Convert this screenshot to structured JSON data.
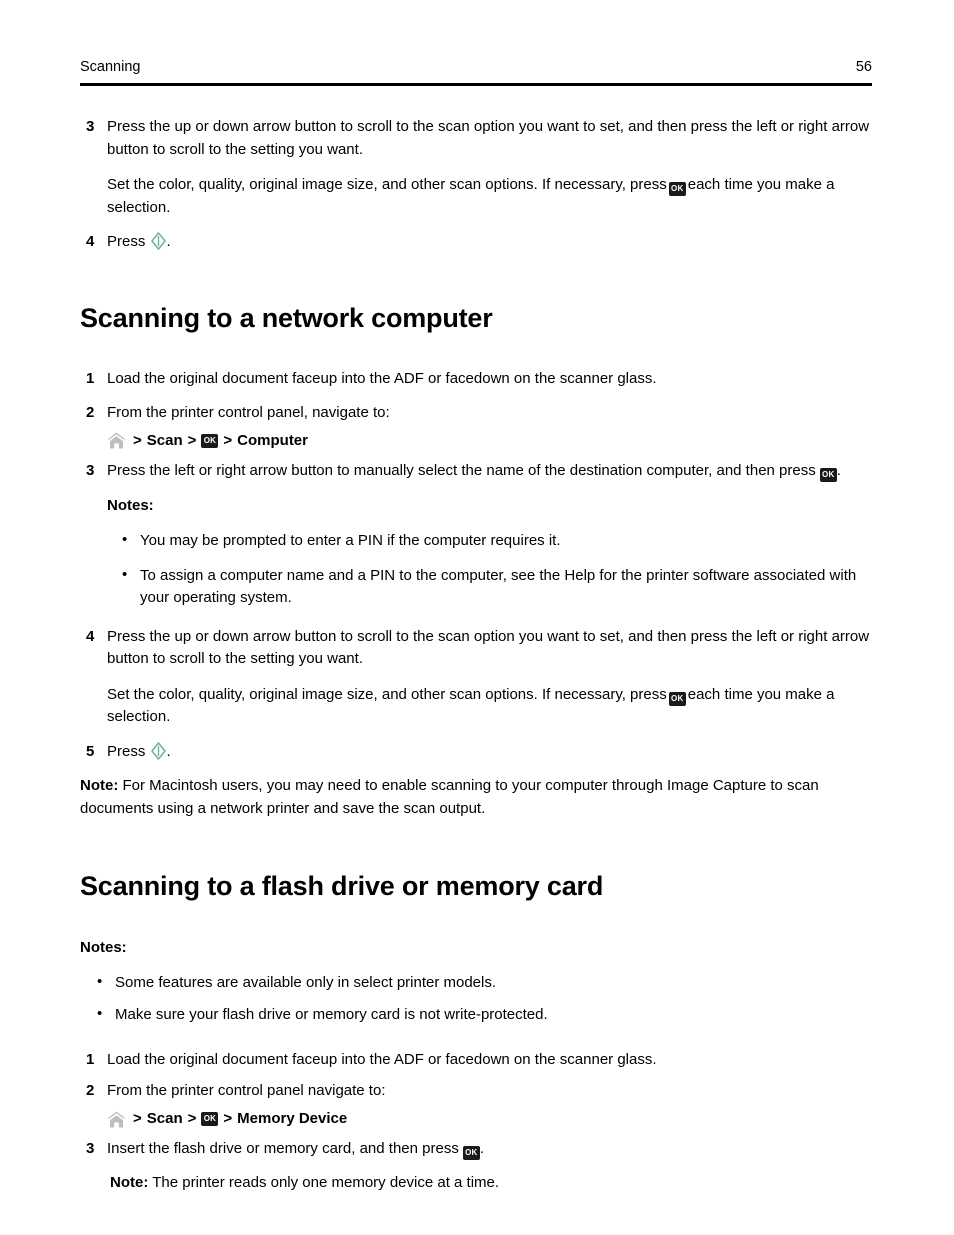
{
  "header": {
    "title": "Scanning",
    "page_number": "56"
  },
  "icons": {
    "ok_label": "OK",
    "home_name": "home-icon",
    "start_name": "start-button-icon",
    "start_color": "#6fb3a8"
  },
  "section_top": {
    "step3": {
      "number": "3",
      "text": "Press the up or down arrow button to scroll to the scan option you want to set, and then press the left or right arrow button to scroll to the setting you want.",
      "extra_before": "Set the color, quality, original image size, and other scan options. If necessary, press",
      "extra_after": "each time you make a selection."
    },
    "step4": {
      "number": "4",
      "text_before": "Press",
      "text_after": "."
    }
  },
  "section_network": {
    "heading": "Scanning to a network computer",
    "step1": {
      "number": "1",
      "text": "Load the original document faceup into the ADF or facedown on the scanner glass."
    },
    "step2": {
      "number": "2",
      "text": "From the printer control panel, navigate to:",
      "nav": {
        "separator": ">",
        "label1": "Scan",
        "label2": "Computer"
      }
    },
    "step3": {
      "number": "3",
      "text_before": "Press the left or right arrow button to manually select the name of the destination computer, and then press",
      "text_after": "."
    },
    "notes_label": "Notes:",
    "notes": [
      "You may be prompted to enter a PIN if the computer requires it.",
      "To assign a computer name and a PIN to the computer, see the Help for the printer software associated with your operating system."
    ],
    "step4": {
      "number": "4",
      "text": "Press the up or down arrow button to scroll to the scan option you want to set, and then press the left or right arrow button to scroll to the setting you want.",
      "extra_before": "Set the color, quality, original image size, and other scan options. If necessary, press",
      "extra_after": "each time you make a selection."
    },
    "step5": {
      "number": "5",
      "text_before": "Press",
      "text_after": "."
    },
    "note": {
      "label": "Note:",
      "text": "For Macintosh users, you may need to enable scanning to your computer through Image Capture to scan documents using a network printer and save the scan output."
    }
  },
  "section_flash": {
    "heading": "Scanning to a flash drive or memory card",
    "notes_label": "Notes:",
    "notes": [
      "Some features are available only in select printer models.",
      "Make sure your flash drive or memory card is not write-protected."
    ],
    "step1": {
      "number": "1",
      "text": "Load the original document faceup into the ADF or facedown on the scanner glass."
    },
    "step2": {
      "number": "2",
      "text": "From the printer control panel navigate to:",
      "nav": {
        "separator": ">",
        "label1": "Scan",
        "label2": "Memory Device"
      }
    },
    "step3": {
      "number": "3",
      "text_before": "Insert the flash drive or memory card, and then press",
      "text_after": "."
    },
    "note": {
      "label": "Note:",
      "text": "The printer reads only one memory device at a time."
    }
  }
}
